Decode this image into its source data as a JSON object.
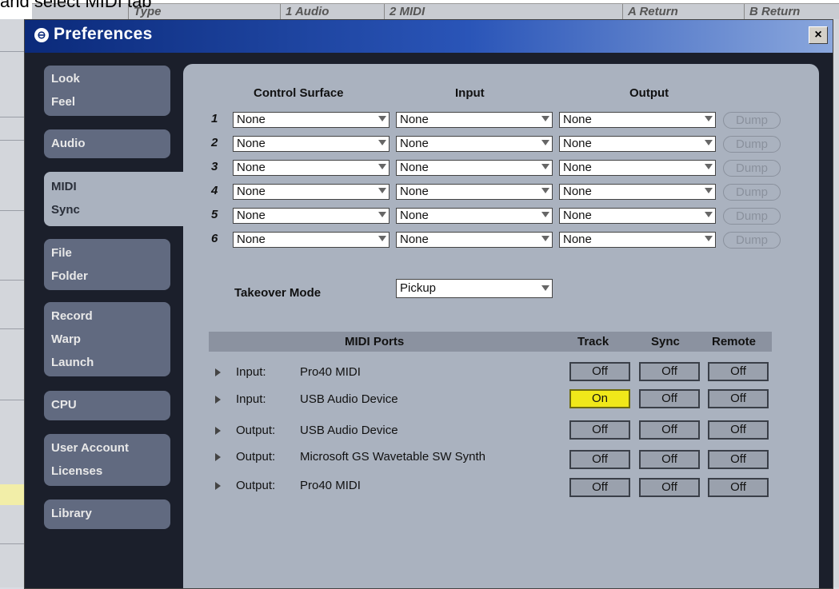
{
  "background": {
    "caption": "and select MIDI tab",
    "header_cells": [
      "Type",
      "1 Audio",
      "2 MIDI",
      "A Return",
      "B Return"
    ]
  },
  "dialog": {
    "title": "Preferences",
    "close_label": "×"
  },
  "tabs": [
    {
      "lines": [
        "Look",
        "Feel"
      ],
      "active": false
    },
    {
      "lines": [
        "Audio"
      ],
      "active": false
    },
    {
      "lines": [
        "MIDI",
        "Sync"
      ],
      "active": true
    },
    {
      "lines": [
        "File",
        "Folder"
      ],
      "active": false
    },
    {
      "lines": [
        "Record",
        "Warp",
        "Launch"
      ],
      "active": false
    },
    {
      "lines": [
        "CPU"
      ],
      "active": false
    },
    {
      "lines": [
        "User Account",
        "Licenses"
      ],
      "active": false
    },
    {
      "lines": [
        "Library"
      ],
      "active": false
    }
  ],
  "control_surfaces": {
    "headers": {
      "surface": "Control Surface",
      "input": "Input",
      "output": "Output"
    },
    "rows": [
      {
        "num": "1",
        "surface": "None",
        "input": "None",
        "output": "None",
        "dump": "Dump"
      },
      {
        "num": "2",
        "surface": "None",
        "input": "None",
        "output": "None",
        "dump": "Dump"
      },
      {
        "num": "3",
        "surface": "None",
        "input": "None",
        "output": "None",
        "dump": "Dump"
      },
      {
        "num": "4",
        "surface": "None",
        "input": "None",
        "output": "None",
        "dump": "Dump"
      },
      {
        "num": "5",
        "surface": "None",
        "input": "None",
        "output": "None",
        "dump": "Dump"
      },
      {
        "num": "6",
        "surface": "None",
        "input": "None",
        "output": "None",
        "dump": "Dump"
      }
    ]
  },
  "takeover": {
    "label": "Takeover Mode",
    "value": "Pickup"
  },
  "midi_ports": {
    "headers": {
      "ports": "MIDI Ports",
      "track": "Track",
      "sync": "Sync",
      "remote": "Remote"
    },
    "rows": [
      {
        "direction": "Input:",
        "name": "Pro40 MIDI",
        "track": "Off",
        "sync": "Off",
        "remote": "Off"
      },
      {
        "direction": "Input:",
        "name": "USB Audio Device",
        "track": "On",
        "sync": "Off",
        "remote": "Off"
      },
      {
        "direction": "Output:",
        "name": "USB Audio Device",
        "track": "Off",
        "sync": "Off",
        "remote": "Off"
      },
      {
        "direction": "Output:",
        "name": "Microsoft GS Wavetable SW Synth",
        "track": "Off",
        "sync": "Off",
        "remote": "Off"
      },
      {
        "direction": "Output:",
        "name": "Pro40 MIDI",
        "track": "Off",
        "sync": "Off",
        "remote": "Off"
      }
    ]
  },
  "colors": {
    "on_button": "#f0e81a",
    "panel": "#aab2bf",
    "dialog_bg": "#1b1f2b",
    "title_bar": "#0b2a7a"
  }
}
